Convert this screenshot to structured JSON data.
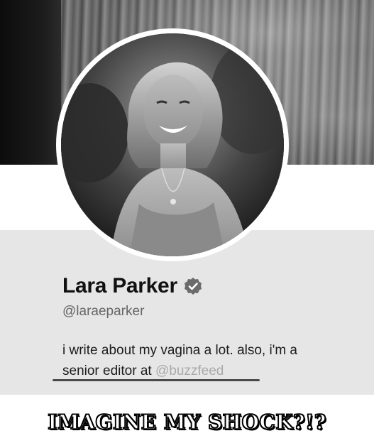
{
  "profile": {
    "display_name": "Lara Parker",
    "handle": "@laraeparker",
    "verified": true,
    "bio_line_1": "i write about my vagina a lot. also, i'm a",
    "bio_line_2_prefix": "senior editor at ",
    "bio_mention": "@buzzfeed"
  },
  "caption": {
    "text": "IMAGINE MY SHOCK?!?"
  },
  "colors": {
    "panel_background": "#e6e6e6",
    "mention_color": "#a9a9a9",
    "name_color": "#111111",
    "handle_color": "#666666"
  },
  "icons": {
    "verified_badge": "verified-badge-icon"
  }
}
